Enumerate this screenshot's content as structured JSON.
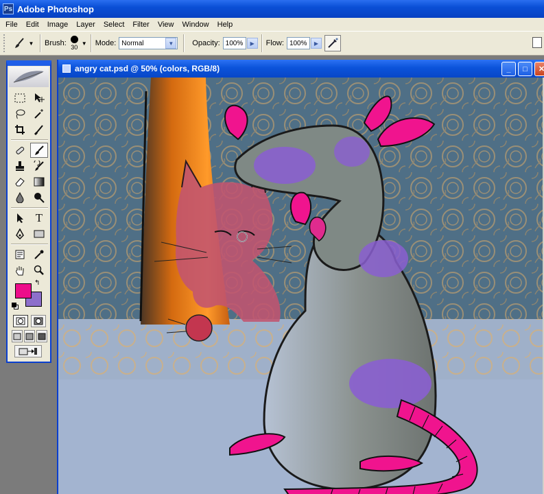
{
  "app": {
    "title": "Adobe Photoshop"
  },
  "menu": [
    "File",
    "Edit",
    "Image",
    "Layer",
    "Select",
    "Filter",
    "View",
    "Window",
    "Help"
  ],
  "options": {
    "brush_label": "Brush:",
    "brush_size": "30",
    "mode_label": "Mode:",
    "mode_value": "Normal",
    "opacity_label": "Opacity:",
    "opacity_value": "100%",
    "flow_label": "Flow:",
    "flow_value": "100%"
  },
  "toolbox": {
    "active_tool": "brush",
    "foreground_color": "#ed0d8a",
    "background_color": "#8d6fcb"
  },
  "document": {
    "title": "angry cat.psd @ 50% (colors, RGB/8)",
    "minimize_label": "_",
    "maximize_label": "□",
    "close_label": "✕"
  },
  "colors": {
    "accent_titlebar": "#0a4fd6",
    "toolbar_bg": "#ece9d8"
  }
}
